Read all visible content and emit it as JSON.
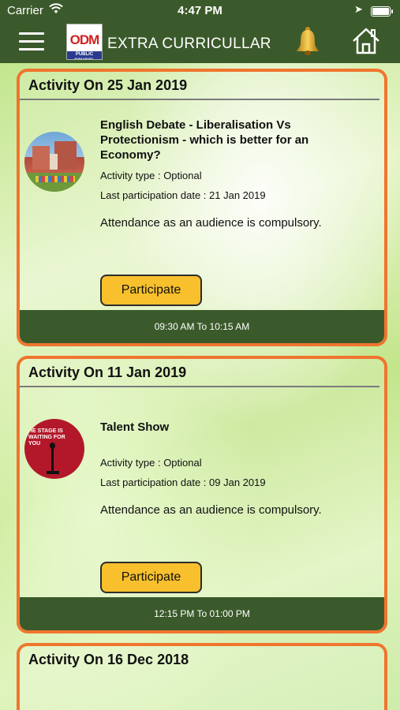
{
  "status_bar": {
    "carrier": "Carrier",
    "time": "4:47 PM"
  },
  "nav": {
    "logo_text": "ODM",
    "logo_sub": "PUBLIC SCHOOL",
    "title": "EXTRA CURRICULLAR",
    "icons": [
      "menu-icon",
      "bell-icon",
      "home-icon"
    ]
  },
  "colors": {
    "header_green": "#3b5a2b",
    "card_border": "#f0752e",
    "button_yellow": "#f7c02c"
  },
  "activities": [
    {
      "header": "Activity On 25 Jan 2019",
      "title": "English Debate - Liberalisation Vs Protectionism - which is better for an Economy?",
      "type": "Activity type : Optional",
      "last_date": "Last participation date : 21 Jan 2019",
      "note": "Attendance as an audience is compulsory.",
      "button": "Participate",
      "time": "09:30 AM To 10:15 AM"
    },
    {
      "header": "Activity On 11 Jan 2019",
      "title": "Talent Show",
      "image_text": "HE STAGE IS WAITING FOR YOU",
      "type": "Activity type : Optional",
      "last_date": "Last participation date : 09 Jan 2019",
      "note": "Attendance as an audience is compulsory.",
      "button": "Participate",
      "time": "12:15 PM To 01:00 PM"
    },
    {
      "header": "Activity On 16 Dec 2018"
    }
  ]
}
